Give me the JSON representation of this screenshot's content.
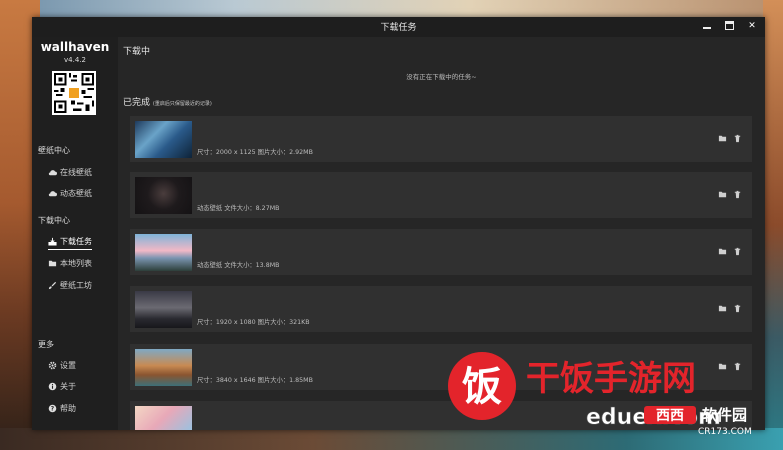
{
  "window": {
    "title": "下载任务"
  },
  "sidebar": {
    "app_name": "wallhaven",
    "version": "v4.4.2",
    "sections": {
      "wallpaper_center": "壁纸中心",
      "download_center": "下载中心",
      "more": "更多"
    },
    "items": {
      "online": "在线壁纸",
      "dynamic": "动态壁纸",
      "download_tasks": "下载任务",
      "local_list": "本地列表",
      "workshop": "壁纸工坊",
      "settings": "设置",
      "about": "关于",
      "help": "帮助"
    }
  },
  "main": {
    "downloading_title": "下载中",
    "empty_message": "没有正在下载中的任务~",
    "completed_title": "已完成",
    "completed_note": "(重启后只保留最近的记录)",
    "rows": [
      {
        "info": "尺寸：2000 x 1125   图片大小：2.92MB"
      },
      {
        "info": "动态壁纸   文件大小：8.27MB"
      },
      {
        "info": "动态壁纸   文件大小：13.8MB"
      },
      {
        "info": "尺寸：1920 x 1080   图片大小：321KB"
      },
      {
        "info": "尺寸：3840 x 1646   图片大小：1.85MB"
      },
      {
        "info": ""
      }
    ]
  },
  "watermark": {
    "brand_cn": "干饭手游网",
    "brand_char": "饭",
    "site": "eduex.com",
    "xixi": "西西",
    "software": "软件园",
    "cr173": "CR173.COM"
  },
  "colors": {
    "window_bg": "#262626",
    "sidebar_bg": "#1f1f1f",
    "row_bg": "#303030",
    "watermark_red": "#e3242b"
  }
}
